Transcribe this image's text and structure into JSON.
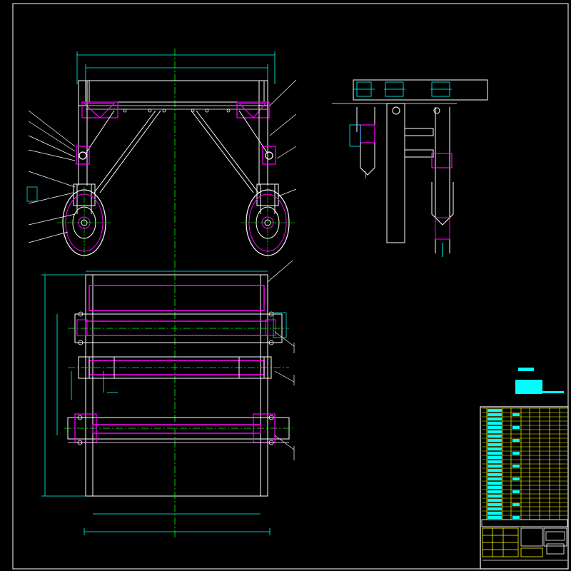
{
  "drawing": {
    "colors": {
      "background": "#000000",
      "outline": "#ffffff",
      "dimension": "#00ffff",
      "centerline": "#00ff00",
      "part_highlight": "#ff00ff",
      "title_block_line": "#ffff00",
      "title_block_fill": "#00ffff"
    },
    "views": [
      "front-view",
      "side-view",
      "top-view",
      "title-block",
      "technical-notes"
    ],
    "icons": [
      "balloon-leader",
      "wheel",
      "bearing-housing",
      "shaft",
      "centerline"
    ]
  }
}
